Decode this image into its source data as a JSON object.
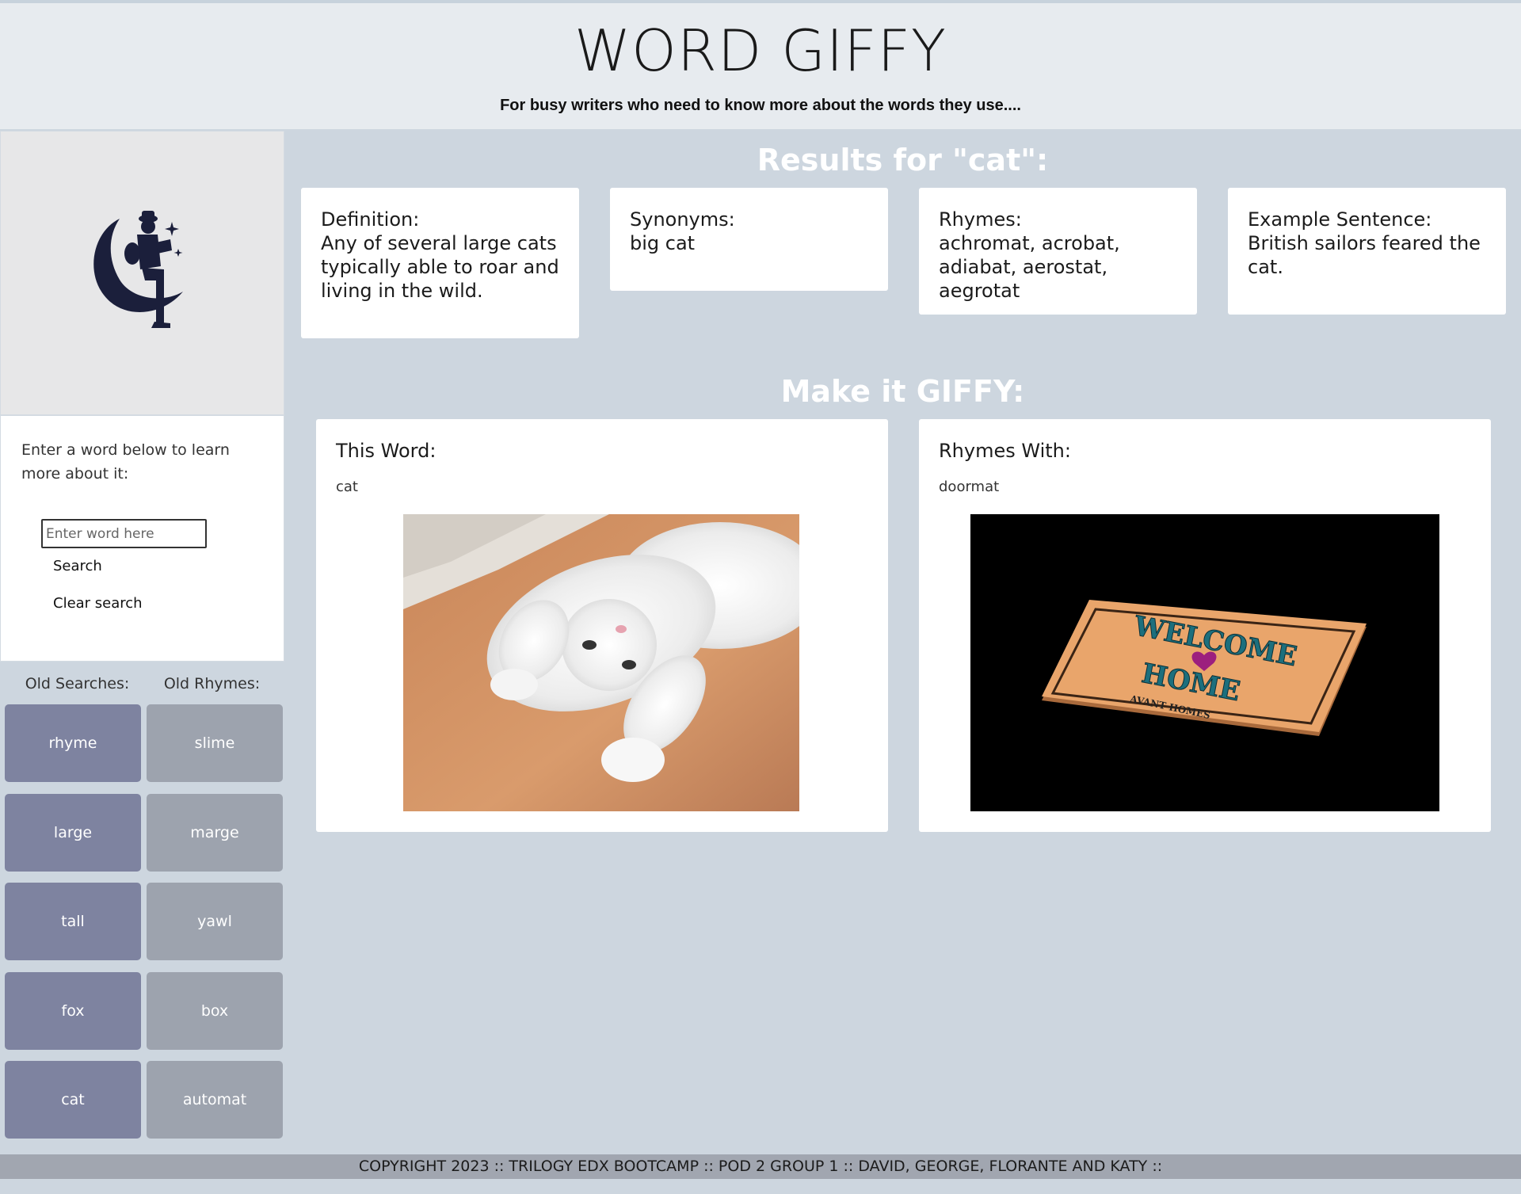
{
  "header": {
    "title": "WORD GIFFY",
    "tagline": "For busy writers who need to know more about the words they use...."
  },
  "sidebar": {
    "logo_icon": "moon-reader-icon",
    "prompt": "Enter a word below to learn more about it:",
    "search_placeholder": "Enter word here",
    "search_value": "",
    "search_label": "Search",
    "clear_label": "Clear search",
    "old_searches_label": "Old Searches:",
    "old_rhymes_label": "Old Rhymes:",
    "old_searches": [
      "rhyme",
      "large",
      "tall",
      "fox",
      "cat"
    ],
    "old_rhymes": [
      "slime",
      "marge",
      "yawl",
      "box",
      "automat"
    ]
  },
  "results": {
    "title": "Results for \"cat\":",
    "definition_label": "Definition:",
    "definition": "Any of several large cats typically able to roar and living in the wild.",
    "synonyms_label": "Synonyms:",
    "synonyms": "big cat",
    "rhymes_label": "Rhymes:",
    "rhymes": "achromat, acrobat, adiabat, aerostat, aegrotat",
    "example_label": "Example Sentence:",
    "example": "British sailors feared the cat."
  },
  "giffy": {
    "title": "Make it GIFFY:",
    "this_word_label": "This Word:",
    "this_word": "cat",
    "this_word_image": "white-kitten-gif",
    "rhymes_with_label": "Rhymes With:",
    "rhymes_with": "doormat",
    "rhymes_with_image": "welcome-home-doormat-gif",
    "doormat_text_1": "WELCOME",
    "doormat_text_2": "HOME",
    "doormat_text_3": "AVANT HOMES"
  },
  "footer": {
    "copyright": "COPYRIGHT 2023 :: TRILOGY EDX BOOTCAMP :: POD 2 GROUP 1 :: DAVID, GEORGE, FLORANTE AND KATY ::"
  }
}
